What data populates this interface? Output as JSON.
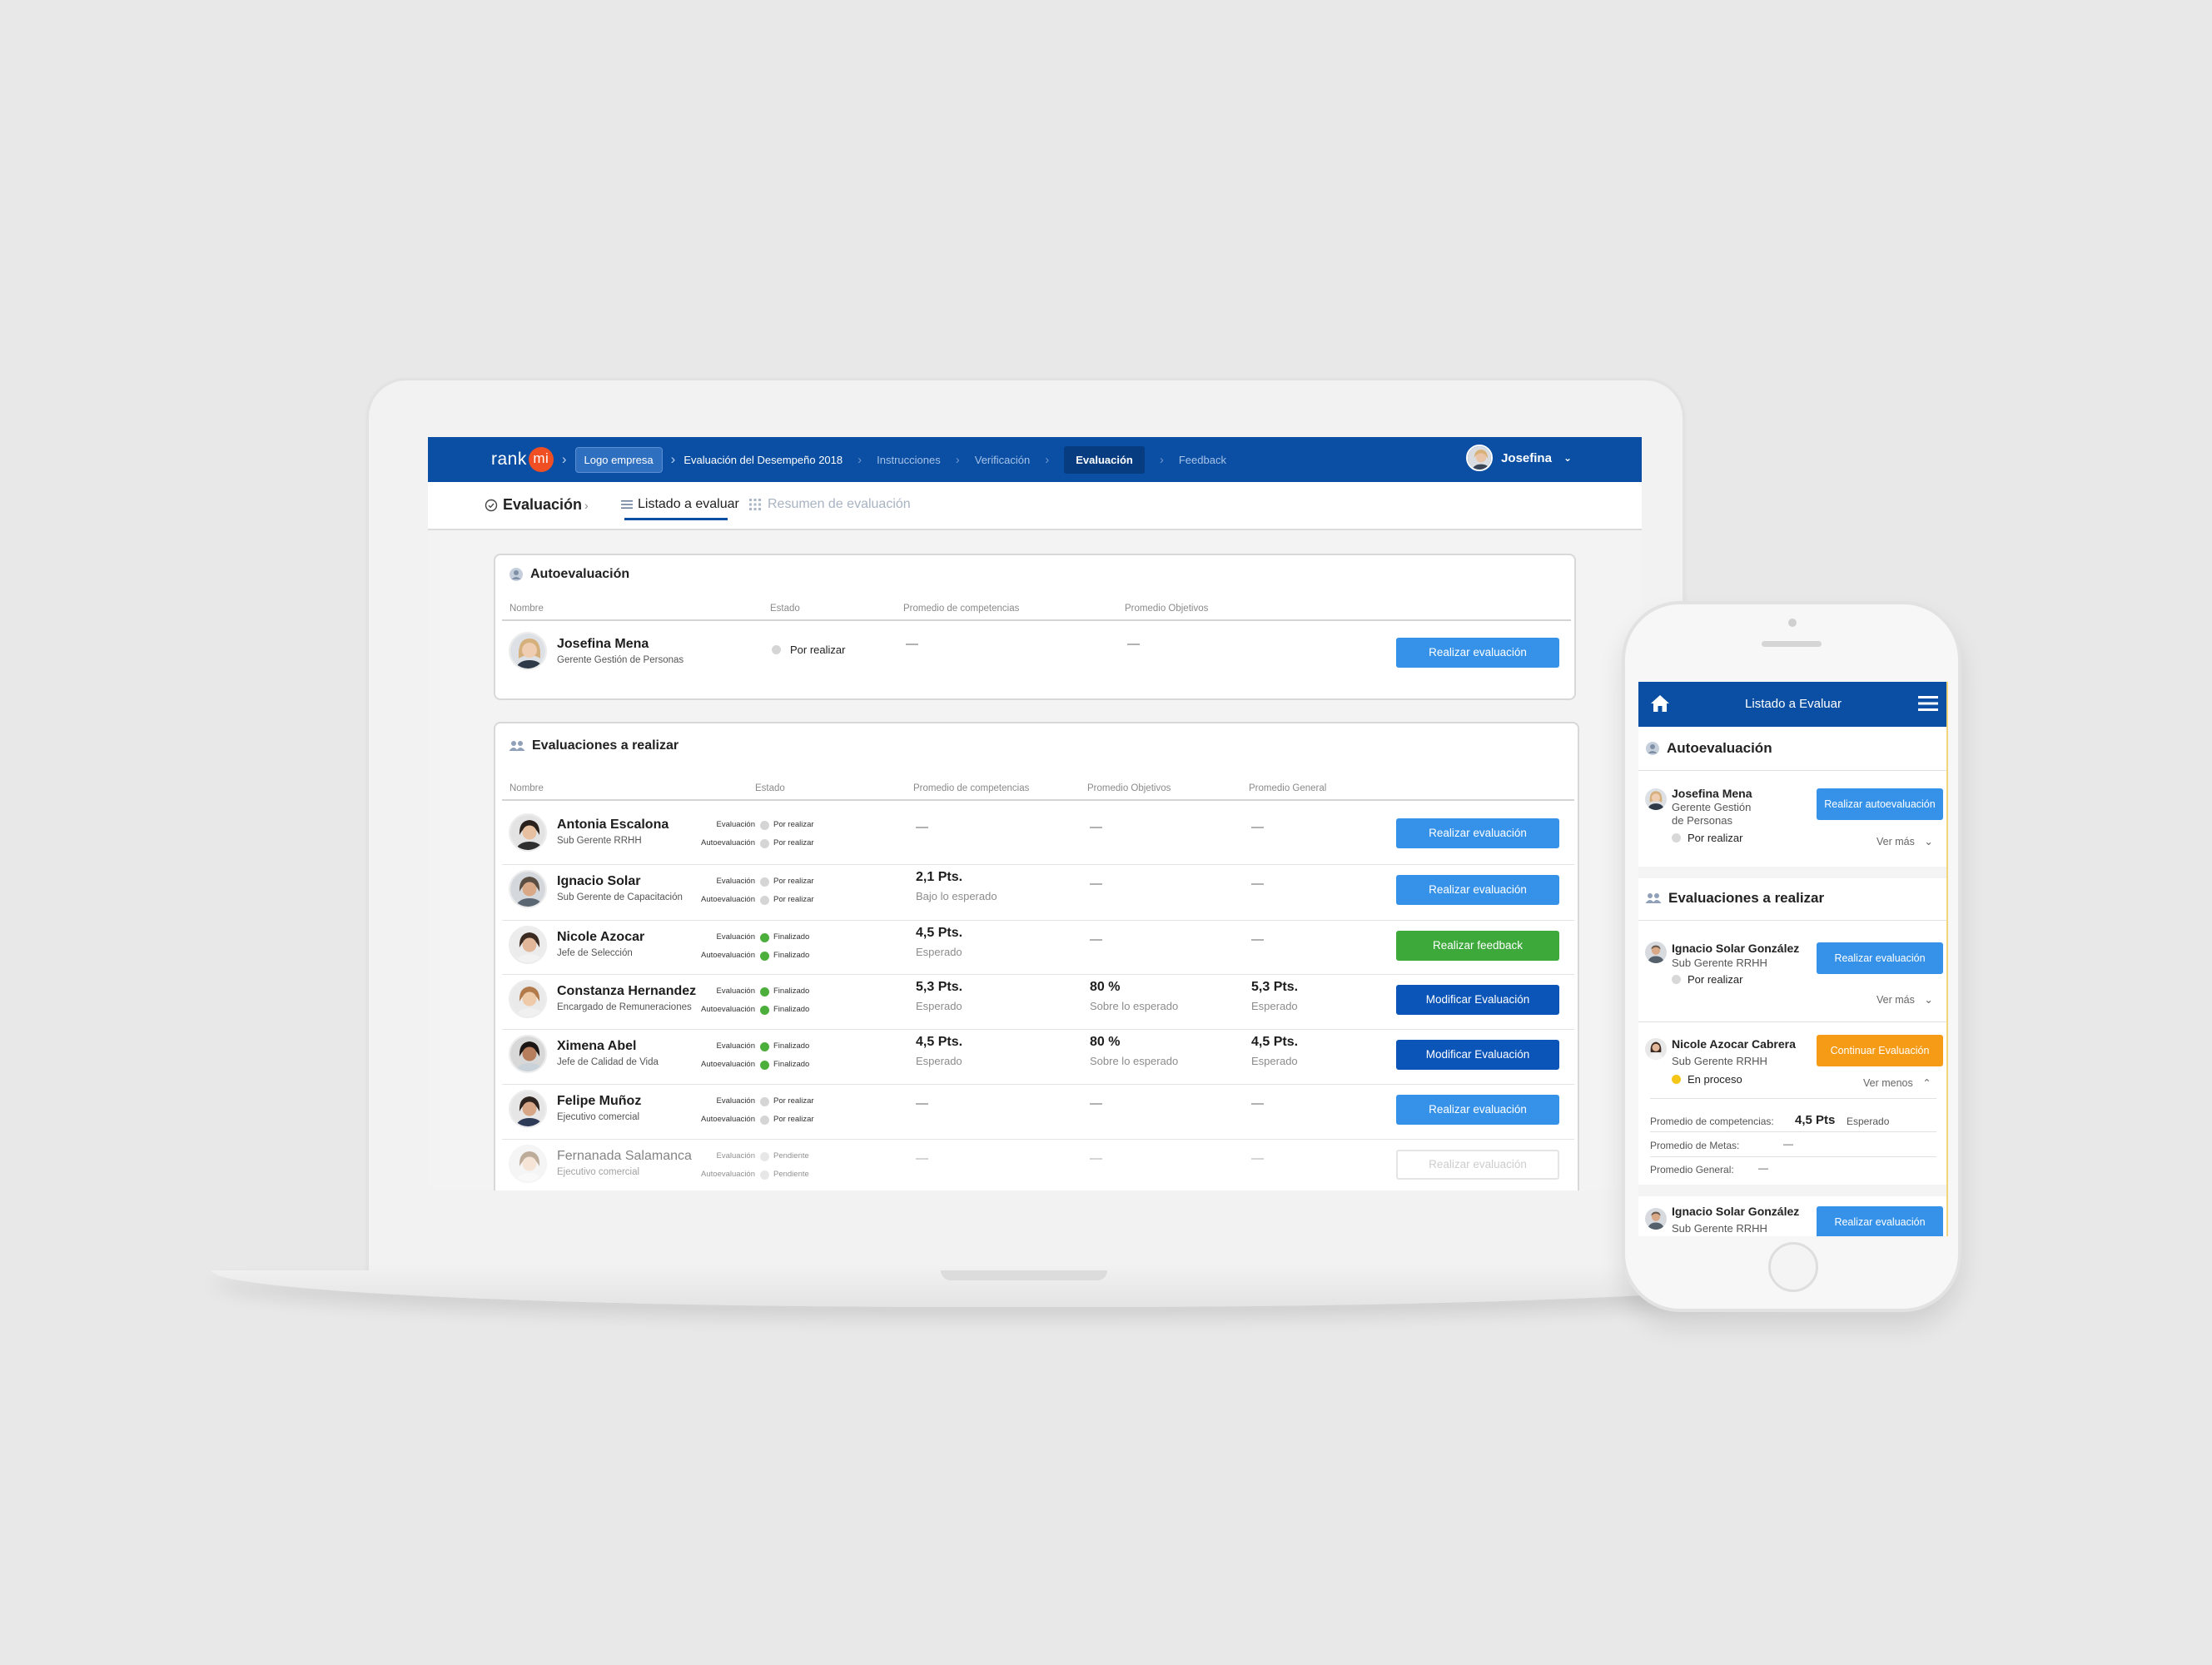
{
  "colors": {
    "brand_blue": "#0a4fa3",
    "button_blue": "#3592e8",
    "button_dark": "#0b55b8",
    "button_green": "#3ca93a",
    "button_orange": "#f59b16",
    "logo_red": "#f04e23"
  },
  "topnav": {
    "logo_text": "rank",
    "logo_mi": "mi",
    "logo_box": "Logo empresa",
    "process": "Evaluación del Desempeño 2018",
    "steps": [
      "Instrucciones",
      "Verificación",
      "Evaluación",
      "Feedback"
    ],
    "active_step": "Evaluación",
    "user_name": "Josefina"
  },
  "subnav": {
    "section": "Evaluación",
    "tab_list": "Listado a evaluar",
    "tab_summary": "Resumen de evaluación"
  },
  "self_eval": {
    "title": "Autoevaluación",
    "columns": [
      "Nombre",
      "Estado",
      "Promedio de competencias",
      "Promedio Objetivos"
    ],
    "row": {
      "name": "Josefina Mena",
      "role": "Gerente Gestión de Personas",
      "status": "Por realizar",
      "competencias": "—",
      "objetivos": "—",
      "action": "Realizar evaluación"
    }
  },
  "evaluations": {
    "title": "Evaluaciones a realizar",
    "columns": [
      "Nombre",
      "Estado",
      "Promedio de competencias",
      "Promedio Objetivos",
      "Promedio General"
    ],
    "status_labels": {
      "eval": "Evaluación",
      "auto": "Autoevaluación"
    },
    "rows": [
      {
        "name": "Antonia Escalona",
        "role": "Sub Gerente RRHH",
        "eval_status": "Por realizar",
        "auto_status": "Por realizar",
        "comp": "—",
        "comp_sub": "",
        "obj": "—",
        "obj_sub": "",
        "gen": "—",
        "gen_sub": "",
        "action": "Realizar evaluación"
      },
      {
        "name": "Ignacio Solar",
        "role": "Sub Gerente de Capacitación",
        "eval_status": "Por realizar",
        "auto_status": "Por realizar",
        "comp": "2,1 Pts.",
        "comp_sub": "Bajo lo esperado",
        "obj": "—",
        "obj_sub": "",
        "gen": "—",
        "gen_sub": "",
        "action": "Realizar evaluación"
      },
      {
        "name": "Nicole Azocar",
        "role": "Jefe de Selección",
        "eval_status": "Finalizado",
        "auto_status": "Finalizado",
        "comp": "4,5 Pts.",
        "comp_sub": "Esperado",
        "obj": "—",
        "obj_sub": "",
        "gen": "—",
        "gen_sub": "",
        "action": "Realizar feedback"
      },
      {
        "name": "Constanza Hernandez",
        "role": "Encargado de Remuneraciones",
        "eval_status": "Finalizado",
        "auto_status": "Finalizado",
        "comp": "5,3 Pts.",
        "comp_sub": "Esperado",
        "obj": "80 %",
        "obj_sub": "Sobre lo esperado",
        "gen": "5,3 Pts.",
        "gen_sub": "Esperado",
        "action": "Modificar Evaluación"
      },
      {
        "name": "Ximena Abel",
        "role": "Jefe de Calidad de Vida",
        "eval_status": "Finalizado",
        "auto_status": "Finalizado",
        "comp": "4,5 Pts.",
        "comp_sub": "Esperado",
        "obj": "80 %",
        "obj_sub": "Sobre lo esperado",
        "gen": "4,5 Pts.",
        "gen_sub": "Esperado",
        "action": "Modificar Evaluación"
      },
      {
        "name": "Felipe Muñoz",
        "role": "Ejecutivo comercial",
        "eval_status": "Por realizar",
        "auto_status": "Por realizar",
        "comp": "—",
        "comp_sub": "",
        "obj": "—",
        "obj_sub": "",
        "gen": "—",
        "gen_sub": "",
        "action": "Realizar evaluación"
      },
      {
        "name": "Fernanada Salamanca",
        "role": "Ejecutivo comercial",
        "eval_status": "Pendiente",
        "auto_status": "Pendiente",
        "comp": "—",
        "comp_sub": "",
        "obj": "—",
        "obj_sub": "",
        "gen": "—",
        "gen_sub": "",
        "action": "Realizar evaluación"
      }
    ]
  },
  "mobile": {
    "title": "Listado a Evaluar",
    "self_section": "Autoevaluación",
    "self": {
      "name": "Josefina Mena",
      "role": "Gerente Gestión de Personas",
      "status": "Por realizar",
      "more": "Ver más",
      "action": "Realizar autoevaluación"
    },
    "eval_section": "Evaluaciones a realizar",
    "items": [
      {
        "name": "Ignacio Solar González",
        "role": "Sub Gerente RRHH",
        "status": "Por realizar",
        "more": "Ver más",
        "action": "Realizar evaluación"
      },
      {
        "name": "Nicole Azocar Cabrera",
        "role": "Sub Gerente RRHH",
        "status": "En proceso",
        "more": "Ver menos",
        "action": "Continuar Evaluación"
      },
      {
        "name": "Ignacio Solar González",
        "role": "Sub Gerente RRHH",
        "action": "Realizar evaluación"
      }
    ],
    "details": {
      "comp_label": "Promedio de competencias:",
      "comp_value": "4,5 Pts",
      "comp_sub": "Esperado",
      "metas_label": "Promedio de Metas:",
      "metas_value": "—",
      "general_label": "Promedio General:",
      "general_value": "—"
    }
  }
}
